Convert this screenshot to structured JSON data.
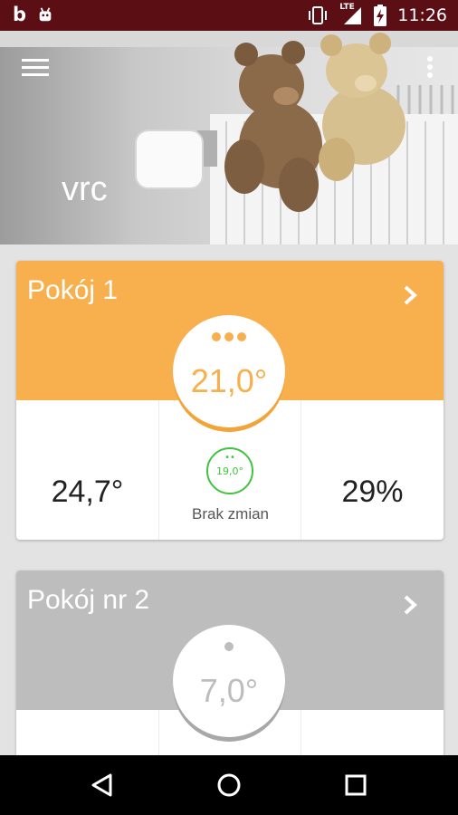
{
  "status_bar": {
    "left_letter": "b",
    "icons": [
      "android-icon",
      "vibrate-icon",
      "lte-signal-icon",
      "battery-charging-icon"
    ],
    "network_label": "LTE",
    "time": "11:26"
  },
  "header": {
    "title": "vrc",
    "icons": [
      "menu-icon",
      "more-vert-icon"
    ]
  },
  "rooms": [
    {
      "name": "Pokój 1",
      "target_temp": "21,0°",
      "accent_color": "#f8b04e",
      "current_temp": "24,7°",
      "schedule_temp": "19,0°",
      "schedule_status": "Brak zmian",
      "humidity": "29%"
    },
    {
      "name": "Pokój nr 2",
      "target_temp": "7,0°",
      "accent_color": "#bdbdbd"
    }
  ],
  "colors": {
    "status_bar": "#5b0e14",
    "schedule_ok": "#3ec43f"
  },
  "nav_bar": {
    "icons": [
      "back-icon",
      "home-icon",
      "recents-icon"
    ]
  }
}
